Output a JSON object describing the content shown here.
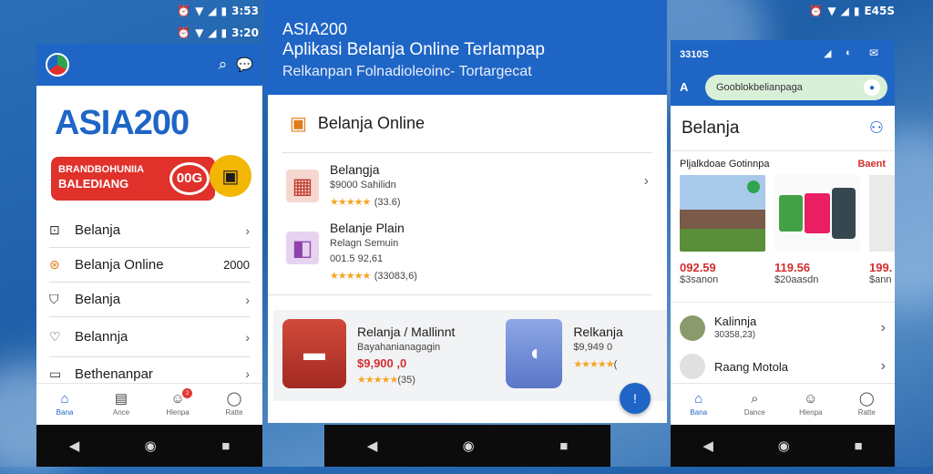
{
  "phone1": {
    "status_time": "3:53",
    "status_time2": "3:20",
    "brand": "ASIA200",
    "banner_text_line1": "BRANDBOHUNIIA",
    "banner_text_line2": "BALEDIANG",
    "banner_badge": "00G",
    "menu": [
      {
        "label": "Belanja",
        "value": "",
        "icon": "bag-icon"
      },
      {
        "label": "Belanja  Online",
        "value": "2000",
        "icon": "cart-icon"
      },
      {
        "label": "Belanja",
        "value": "",
        "icon": "shield-icon"
      },
      {
        "label": "Belannja",
        "value": "",
        "icon": "heart-icon"
      },
      {
        "label": "Bethenanpar",
        "value": "",
        "icon": "card-icon"
      }
    ],
    "tabs": [
      {
        "label": "Bana",
        "icon": "home-icon"
      },
      {
        "label": "Ance",
        "icon": "document-icon"
      },
      {
        "label": "Hlenpa",
        "icon": "user-group-icon",
        "badge": "2"
      },
      {
        "label": "Ratte",
        "icon": "profile-icon"
      }
    ]
  },
  "phone2": {
    "header_title": "ASIA200",
    "header_line2": "Aplikasi Belanja Online Terlampap",
    "header_line3": "Relkanpan Folnadioleoinc- Tortargecat",
    "section_title": "Belanja Online",
    "items": [
      {
        "title": "Belangja",
        "subtitle": "$9000 Sahilidn",
        "rating": "★★★★★",
        "rating_text": "(33.6)"
      },
      {
        "title": "Belanje Plain",
        "subtitle": "Relagn Semuin",
        "price": "001.5 92,61",
        "rating": "★★★★★",
        "rating_text": "(33083,6)"
      }
    ],
    "cards": [
      {
        "title": "Relanja / Mallinnt",
        "subtitle": "Bayahanianagagin",
        "price": "$9,900 ,0",
        "rating": "★★★★★",
        "rating_text": "(35)"
      },
      {
        "title": "Relkanja",
        "subtitle": "$9,949 0",
        "rating": "★★★★★",
        "rating_text": "("
      }
    ]
  },
  "phone3": {
    "status_time": "E45S",
    "header_code": "3310S",
    "search_value": "Gooblokbelianpaga",
    "section_title": "Belanja",
    "subheader": "Pljalkdoae Gotinnpa",
    "subheader_link": "Baent",
    "products": [
      {
        "price": "092.59",
        "sub": "$3sanon"
      },
      {
        "price": "119.56",
        "sub": "$20aasdn"
      },
      {
        "price": "199.",
        "sub": "$ann"
      }
    ],
    "list": [
      {
        "title": "Kalinnja",
        "subtitle": "30358,23)"
      },
      {
        "title": "Raang Motola",
        "subtitle": ""
      }
    ],
    "tabs": [
      {
        "label": "Bana",
        "icon": "home-icon"
      },
      {
        "label": "Dance",
        "icon": "search-icon"
      },
      {
        "label": "Hlenpa",
        "icon": "user-group-icon"
      },
      {
        "label": "Ratte",
        "icon": "profile-icon"
      }
    ]
  },
  "colors": {
    "primary": "#1e65c6",
    "red": "#d32f2f",
    "star": "#f5a623",
    "banner_red": "#e0312b",
    "banner_yellow": "#f2b705"
  }
}
